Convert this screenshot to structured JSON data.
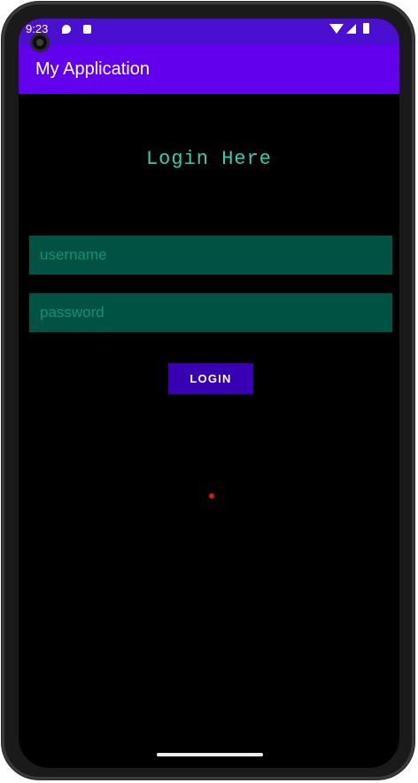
{
  "status_bar": {
    "time": "9:23",
    "icons": [
      "notification-icon",
      "lock-icon",
      "wifi-icon",
      "signal-icon",
      "battery-icon"
    ]
  },
  "app_bar": {
    "title": "My Application"
  },
  "login": {
    "heading": "Login Here",
    "username_placeholder": "username",
    "password_placeholder": "password",
    "button_label": "LOGIN"
  },
  "colors": {
    "app_bar": "#6200ee",
    "status_bar": "#4a0fd0",
    "heading": "#27d3b0",
    "field_background": "#005243",
    "button": "#3700b3"
  }
}
